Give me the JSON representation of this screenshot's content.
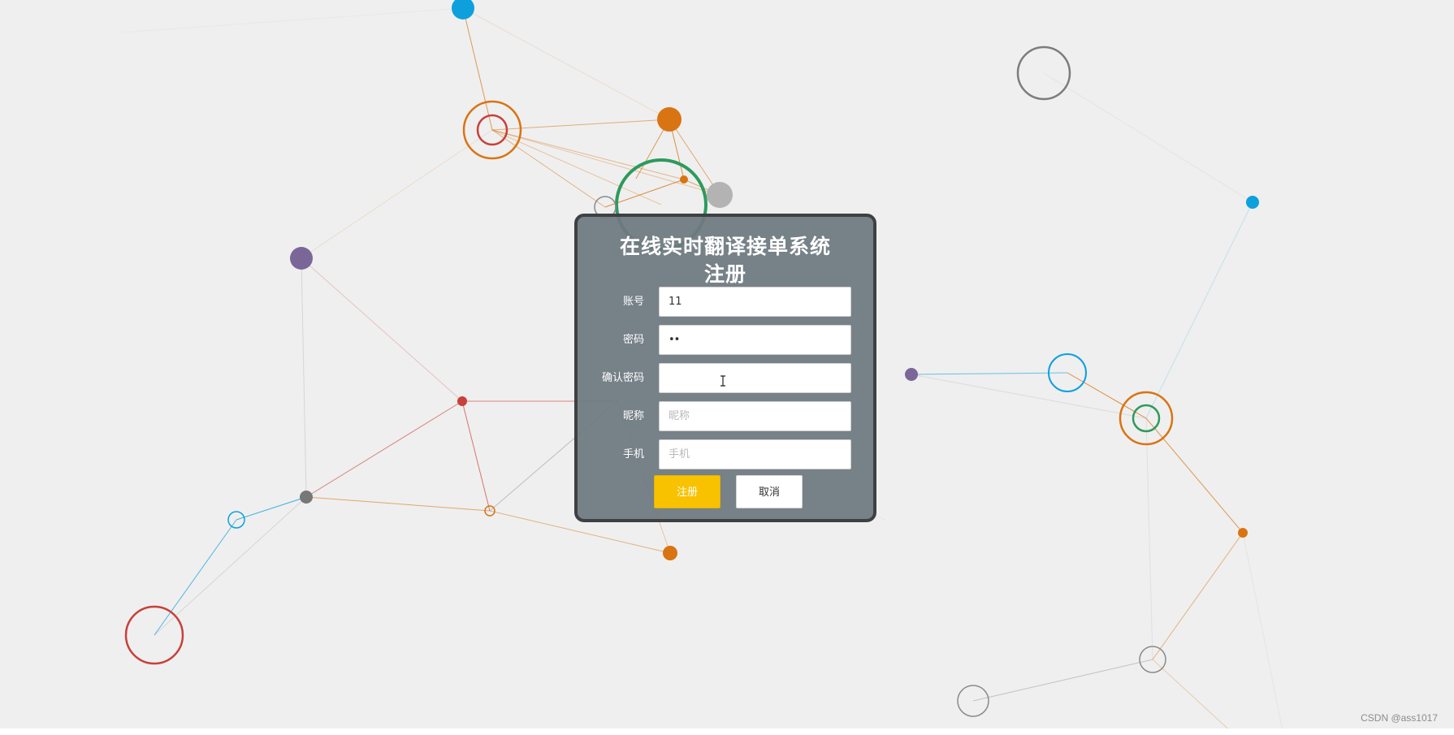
{
  "dialog": {
    "title_line1": "在线实时翻译接单系统",
    "title_line2": "注册"
  },
  "form": {
    "fields": [
      {
        "label": "账号",
        "value": "11",
        "placeholder": ""
      },
      {
        "label": "密码",
        "value": "••",
        "placeholder": ""
      },
      {
        "label": "确认密码",
        "value": "",
        "placeholder": ""
      },
      {
        "label": "昵称",
        "value": "",
        "placeholder": "昵称"
      },
      {
        "label": "手机",
        "value": "",
        "placeholder": "手机"
      }
    ],
    "register_label": "注册",
    "cancel_label": "取消"
  },
  "watermark": "CSDN @ass1017",
  "colors": {
    "background": "#efefef",
    "dialog_bg": "#6e7880",
    "dialog_border": "#3f4043",
    "register_button": "#f8c200",
    "node_orange": "#d97412",
    "node_blue": "#0da0dd",
    "node_red": "#c8403a",
    "node_green": "#2e9a5d",
    "node_purple": "#7a6798",
    "node_gray": "#8a8a8a"
  }
}
